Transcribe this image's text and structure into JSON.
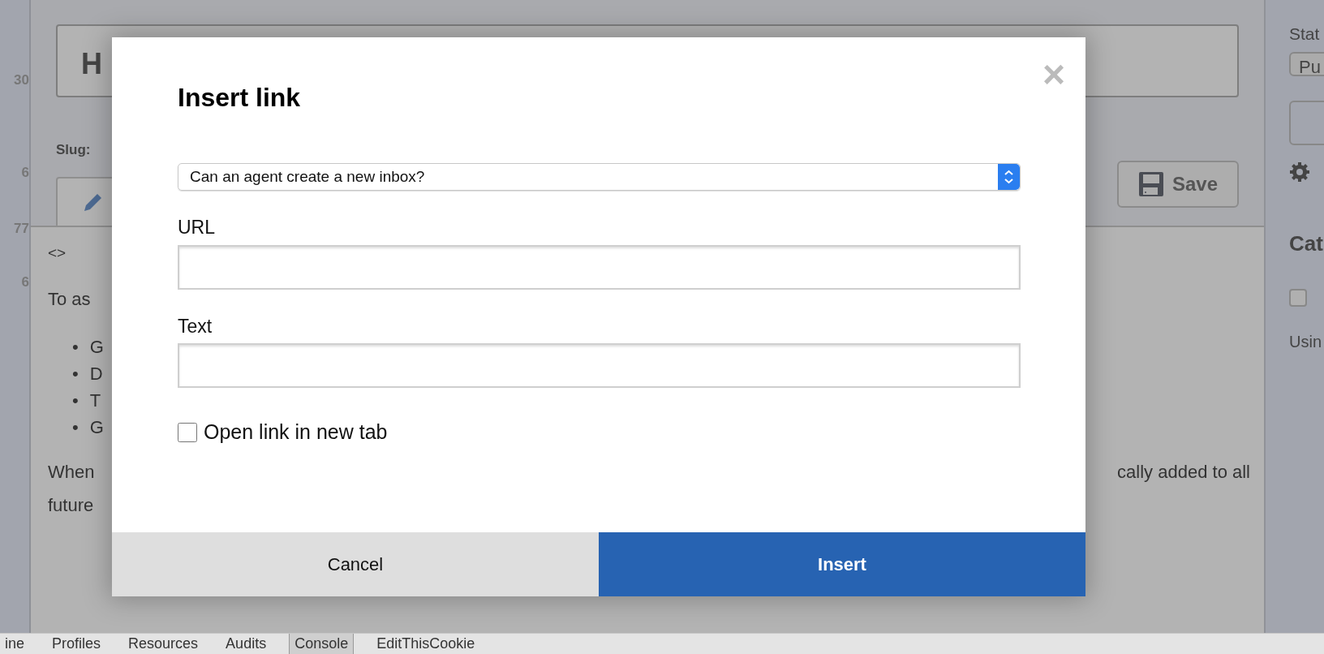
{
  "gutter": {
    "numbers": [
      "30",
      "6",
      "77",
      "6"
    ]
  },
  "editor": {
    "title_value": "H",
    "slug_label": "Slug:",
    "save_button": "Save",
    "toolbar_code": "<>",
    "intro": "To as",
    "bullets": [
      {
        "marker": "•",
        "text": "G"
      },
      {
        "marker": "•",
        "text": "D"
      },
      {
        "marker": "•",
        "text": "T"
      },
      {
        "marker": "•",
        "text": "G"
      }
    ],
    "when_start": "When",
    "when_end": "cally added to all",
    "future_line": "future"
  },
  "sidebar": {
    "status_label": "Stat",
    "status_value": "Pu",
    "categories_heading": "Cat",
    "category_checked": false,
    "using_label": "Usin"
  },
  "modal": {
    "title": "Insert link",
    "close": "×",
    "select_value": "Can an agent create a new inbox?",
    "fields": [
      {
        "label": "URL"
      },
      {
        "label": "Text"
      }
    ],
    "new_tab": {
      "label": "Open link in new tab",
      "checked": false
    },
    "buttons": [
      {
        "label": "Cancel",
        "kind": "secondary"
      },
      {
        "label": "Insert",
        "kind": "primary"
      }
    ]
  },
  "devtools_tabs": [
    {
      "label": "ine",
      "selected": false
    },
    {
      "label": "Profiles",
      "selected": false
    },
    {
      "label": "Resources",
      "selected": false
    },
    {
      "label": "Audits",
      "selected": false
    },
    {
      "label": "Console",
      "selected": true
    },
    {
      "label": "EditThisCookie",
      "selected": false
    }
  ]
}
